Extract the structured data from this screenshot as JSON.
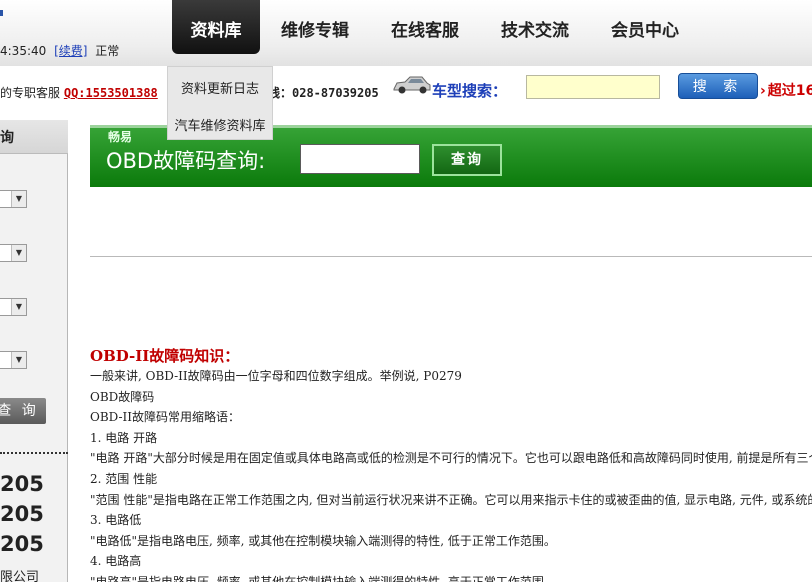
{
  "topbar": {
    "time_text": "4:35:40",
    "renew_label": "[续费]",
    "status_text": "正常",
    "nav": [
      {
        "label": "资料库",
        "active": true
      },
      {
        "label": "维修专辑",
        "active": false
      },
      {
        "label": "在线客服",
        "active": false
      },
      {
        "label": "技术交流",
        "active": false
      },
      {
        "label": "会员中心",
        "active": false
      }
    ],
    "dropdown": [
      "资料更新日志",
      "汽车维修资料库"
    ]
  },
  "infobar": {
    "service_prefix": "的专职客服",
    "qq": "QQ:1553501388",
    "hotline": "线：028-87039205",
    "search_label": "车型搜索：",
    "search_value": "",
    "search_button": "搜 索",
    "over_text": "超过16"
  },
  "sidebar": {
    "title": "查询",
    "button": "查 询",
    "numbers": [
      "205",
      "205",
      "205"
    ],
    "company": "限公司"
  },
  "obd": {
    "brand": "畅易",
    "label": "OBD故障码查询:",
    "input_value": "",
    "button": "查询"
  },
  "article": {
    "heading": "OBD-II故障码知识：",
    "lines": [
      "一般来讲, OBD-II故障码由一位字母和四位数字组成。举例说, P0279",
      "OBD故障码",
      "OBD-II故障码常用缩略语：",
      "1. 电路 开路",
      "\"电路 开路\"大部分时候是用在固定值或具体电路高或低的检测是不可行的情况下。它也可以跟电路低和高故障码同时使用, 前提是所有三个",
      "2. 范围 性能",
      "\"范围 性能\"是指电路在正常工作范围之内, 但对当前运行状况来讲不正确。它可以用来指示卡住的或被歪曲的值, 显示电路, 元件, 或系统的",
      "3. 电路低",
      "\"电路低\"是指电路电压, 频率, 或其他在控制模块输入端测得的特性, 低于正常工作范围。",
      "4. 电路高",
      "\"电路高\"是指电路电压, 频率, 或其他在控制模块输入端测得的特性, 高于正常工作范围。"
    ]
  },
  "colors": {
    "accent_red": "#c00000",
    "link_blue": "#1d3fb8",
    "banner_green": "#138513",
    "search_input_bg": "#ffffcc"
  }
}
